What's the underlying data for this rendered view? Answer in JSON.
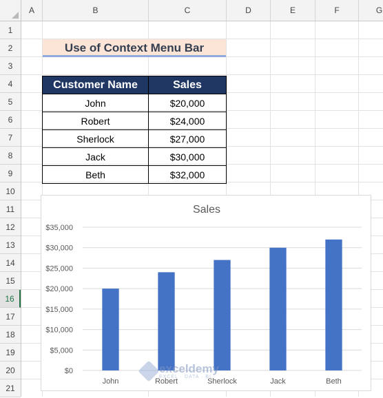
{
  "columns": [
    "A",
    "B",
    "C",
    "D",
    "E",
    "F",
    "G"
  ],
  "rows": [
    "1",
    "2",
    "3",
    "4",
    "5",
    "6",
    "7",
    "8",
    "9",
    "10",
    "11",
    "12",
    "13",
    "14",
    "15",
    "16",
    "17",
    "18",
    "19",
    "20",
    "21"
  ],
  "selected_row": "16",
  "sheet": {
    "title": "Use of Context Menu Bar",
    "table_headers": [
      "Customer Name",
      "Sales"
    ],
    "table_rows": [
      [
        "John",
        "$20,000"
      ],
      [
        "Robert",
        "$24,000"
      ],
      [
        "Sherlock",
        "$27,000"
      ],
      [
        "Jack",
        "$30,000"
      ],
      [
        "Beth",
        "$32,000"
      ]
    ]
  },
  "chart_data": {
    "type": "bar",
    "title": "Sales",
    "categories": [
      "John",
      "Robert",
      "Sherlock",
      "Jack",
      "Beth"
    ],
    "values": [
      20000,
      24000,
      27000,
      30000,
      32000
    ],
    "ylim": [
      0,
      35000
    ],
    "yticks": [
      "$0",
      "$5,000",
      "$10,000",
      "$15,000",
      "$20,000",
      "$25,000",
      "$30,000",
      "$35,000"
    ],
    "bar_color": "#4472c4",
    "grid": true,
    "legend": "none"
  },
  "watermark": {
    "brand": "exceldemy",
    "tagline": "EXCEL · DATA · BI"
  },
  "colors": {
    "header_fill": "#203764",
    "title_fill": "#fce4d6",
    "selection": "#217346"
  }
}
